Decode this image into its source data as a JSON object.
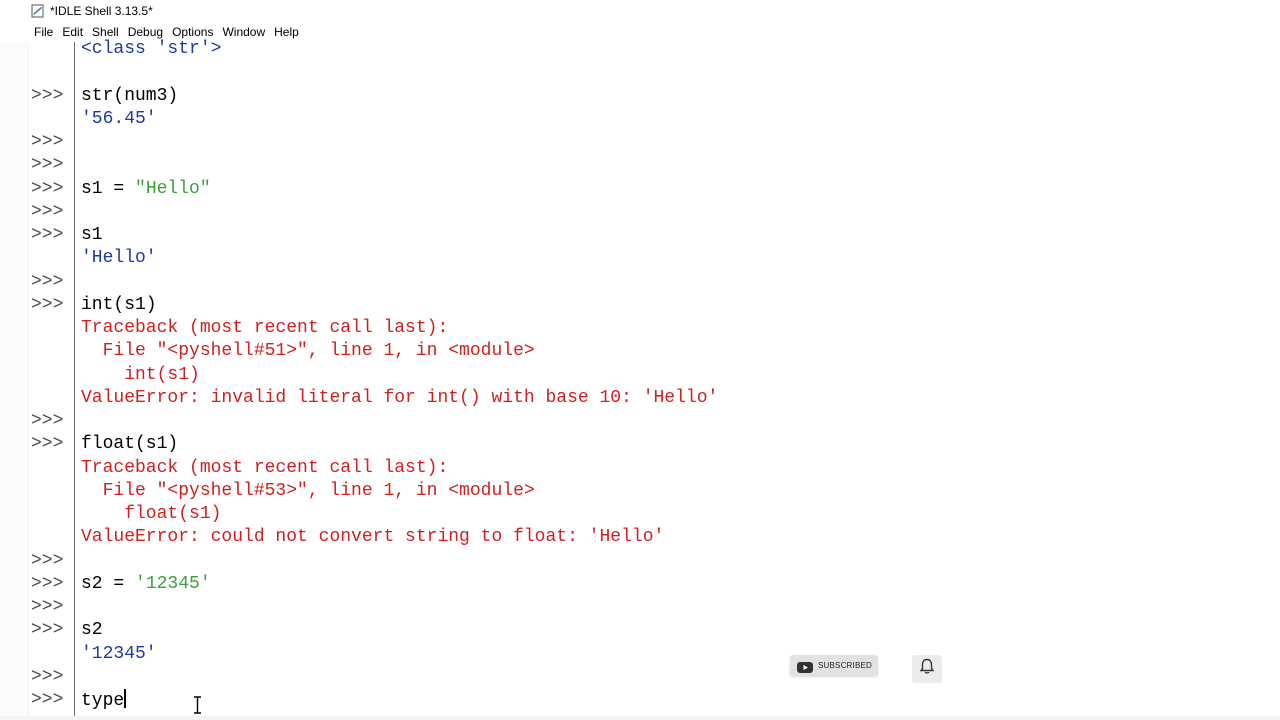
{
  "window": {
    "title": "*IDLE Shell 3.13.5*"
  },
  "menu": [
    "File",
    "Edit",
    "Shell",
    "Debug",
    "Options",
    "Window",
    "Help"
  ],
  "shell_rows": [
    {
      "prompt": "",
      "text": "<class 'str'>",
      "kind": "out"
    },
    {
      "prompt": "",
      "text": "",
      "kind": "plain"
    },
    {
      "prompt": ">>>",
      "text": "str(num3)",
      "kind": "plain"
    },
    {
      "prompt": "",
      "text": "'56.45'",
      "kind": "out"
    },
    {
      "prompt": ">>>",
      "text": "",
      "kind": "plain"
    },
    {
      "prompt": ">>>",
      "text": "",
      "kind": "plain"
    },
    {
      "prompt": ">>>",
      "text": "s1 = ",
      "kind": "plain",
      "str": "\"Hello\""
    },
    {
      "prompt": ">>>",
      "text": "",
      "kind": "plain"
    },
    {
      "prompt": ">>>",
      "text": "s1",
      "kind": "plain"
    },
    {
      "prompt": "",
      "text": "'Hello'",
      "kind": "out"
    },
    {
      "prompt": ">>>",
      "text": "",
      "kind": "plain"
    },
    {
      "prompt": ">>>",
      "text": "int(s1)",
      "kind": "plain"
    },
    {
      "prompt": "",
      "text": "Traceback (most recent call last):",
      "kind": "err"
    },
    {
      "prompt": "",
      "text": "  File \"<pyshell#51>\", line 1, in <module>",
      "kind": "err"
    },
    {
      "prompt": "",
      "text": "    int(s1)",
      "kind": "err"
    },
    {
      "prompt": "",
      "text": "ValueError: invalid literal for int() with base 10: 'Hello'",
      "kind": "err"
    },
    {
      "prompt": ">>>",
      "text": "",
      "kind": "plain"
    },
    {
      "prompt": ">>>",
      "text": "float(s1)",
      "kind": "plain"
    },
    {
      "prompt": "",
      "text": "Traceback (most recent call last):",
      "kind": "err"
    },
    {
      "prompt": "",
      "text": "  File \"<pyshell#53>\", line 1, in <module>",
      "kind": "err"
    },
    {
      "prompt": "",
      "text": "    float(s1)",
      "kind": "err"
    },
    {
      "prompt": "",
      "text": "ValueError: could not convert string to float: 'Hello'",
      "kind": "err"
    },
    {
      "prompt": ">>>",
      "text": "",
      "kind": "plain"
    },
    {
      "prompt": ">>>",
      "text": "s2 = ",
      "kind": "plain",
      "str": "'12345'"
    },
    {
      "prompt": ">>>",
      "text": "",
      "kind": "plain"
    },
    {
      "prompt": ">>>",
      "text": "s2",
      "kind": "plain"
    },
    {
      "prompt": "",
      "text": "'12345'",
      "kind": "out"
    },
    {
      "prompt": ">>>",
      "text": "",
      "kind": "plain"
    },
    {
      "prompt": ">>>",
      "text": "type",
      "kind": "plain",
      "cursor": true
    }
  ],
  "overlay": {
    "subscribed_label": "SUBSCRIBED",
    "subscribe_icon": "youtube-icon",
    "bell_icon": "bell-icon"
  },
  "colors": {
    "output": "#1f3aa3",
    "error": "#d01f1f",
    "string": "#3aa03a",
    "prompt": "#4d4d4d"
  }
}
